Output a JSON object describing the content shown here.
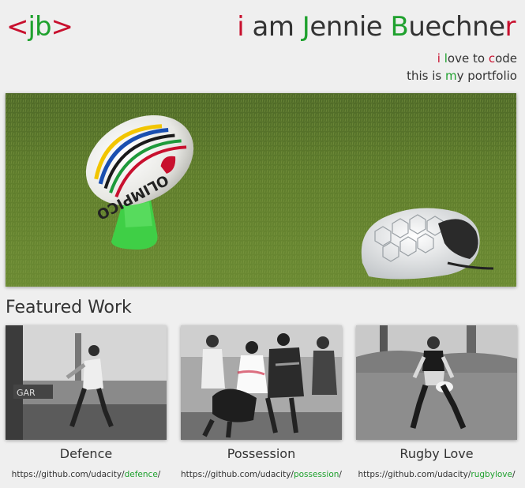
{
  "logo": {
    "open": "<",
    "initials": "jb",
    "close": ">"
  },
  "header": {
    "title_parts": [
      "i",
      " am ",
      "J",
      "ennie ",
      "B",
      "uechne",
      "r"
    ],
    "tagline_line1_parts": [
      "i",
      " ",
      "l",
      "ove to ",
      "c",
      "ode"
    ],
    "tagline_line2_parts": [
      "this is ",
      "m",
      "y portfolio"
    ]
  },
  "hero": {
    "image": "rugby-ball-on-tee-and-scrum-cap-on-grass"
  },
  "featured": {
    "heading": "Featured Work",
    "items": [
      {
        "title": "Defence",
        "link_base": "https://github.com/udacity/",
        "link_slug": "defence",
        "link_end": "/"
      },
      {
        "title": "Possession",
        "link_base": "https://github.com/udacity/",
        "link_slug": "possession",
        "link_end": "/"
      },
      {
        "title": "Rugby Love",
        "link_base": "https://github.com/udacity/",
        "link_slug": "rugbylove",
        "link_end": "/"
      }
    ]
  },
  "colors": {
    "accent_red": "#c8102e",
    "accent_green": "#1fa12e",
    "text": "#333333",
    "background": "#efefef"
  }
}
